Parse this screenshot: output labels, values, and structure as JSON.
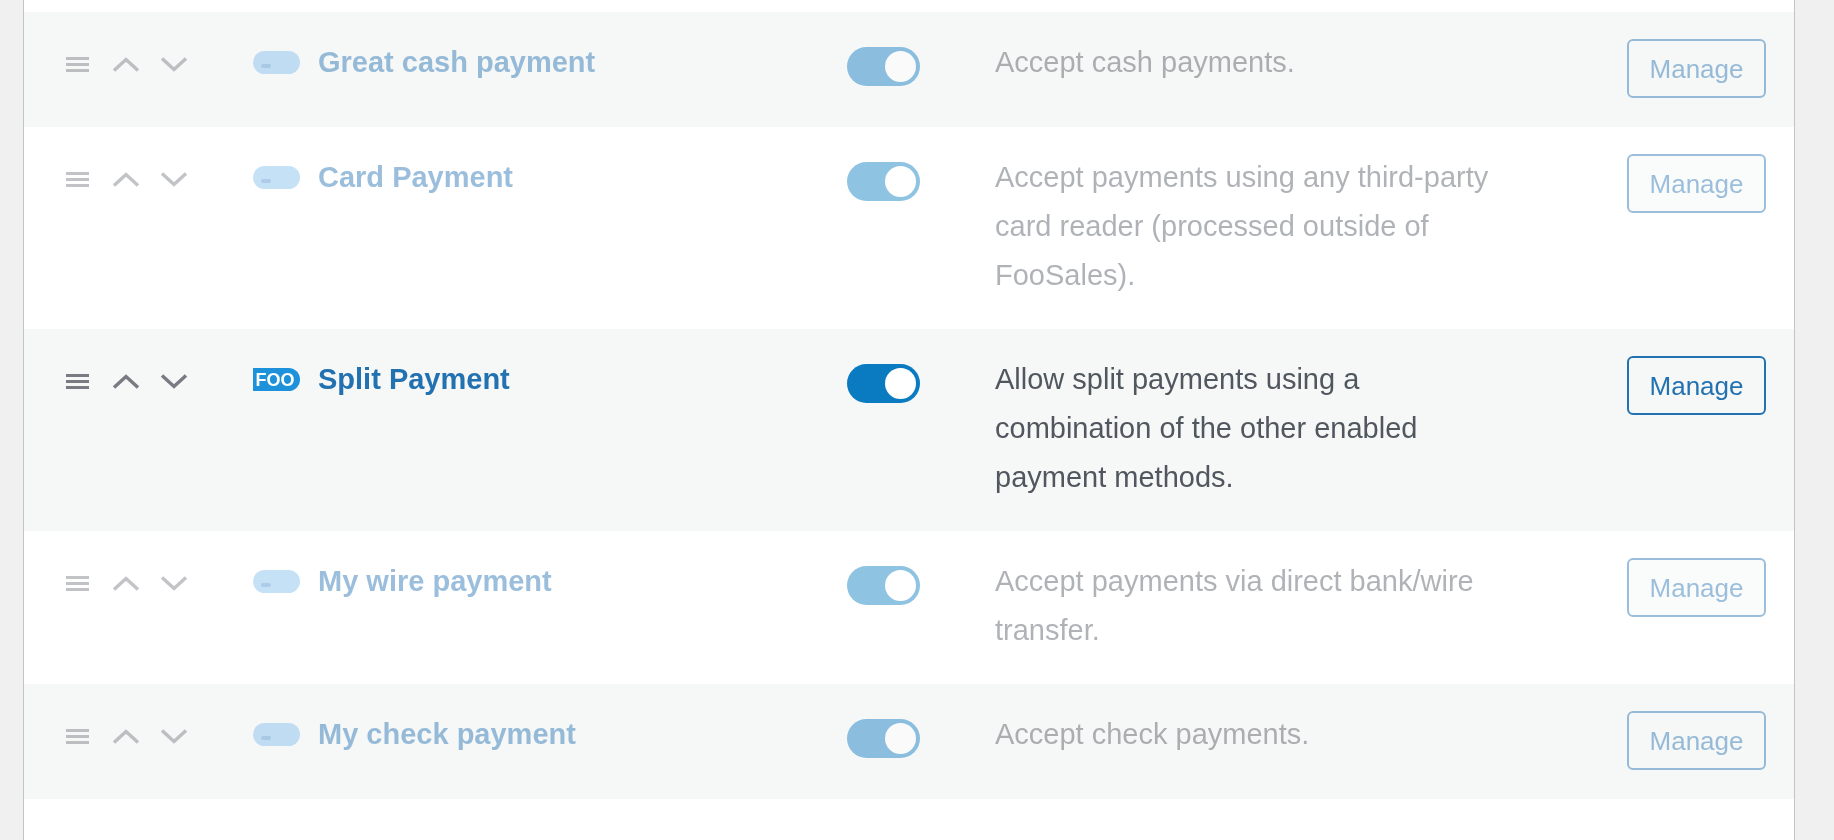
{
  "rows": [
    {
      "title": "Great cash payment",
      "enabled": true,
      "description": "Accept cash payments.",
      "button": "Manage",
      "blurred": true
    },
    {
      "title": "Card Payment",
      "enabled": true,
      "description": "Accept payments using any third-party card reader (processed outside of FooSales).",
      "button": "Manage",
      "blurred": true
    },
    {
      "title": "Split Payment",
      "logo_text": "FOO",
      "enabled": true,
      "description": "Allow split payments using a combination of the other enabled payment methods.",
      "button": "Manage",
      "blurred": false
    },
    {
      "title": "My wire payment",
      "enabled": true,
      "description": "Accept payments via direct bank/wire transfer.",
      "button": "Manage",
      "blurred": true
    },
    {
      "title": "My check payment",
      "enabled": true,
      "description": "Accept check payments.",
      "button": "Manage",
      "blurred": true
    }
  ]
}
